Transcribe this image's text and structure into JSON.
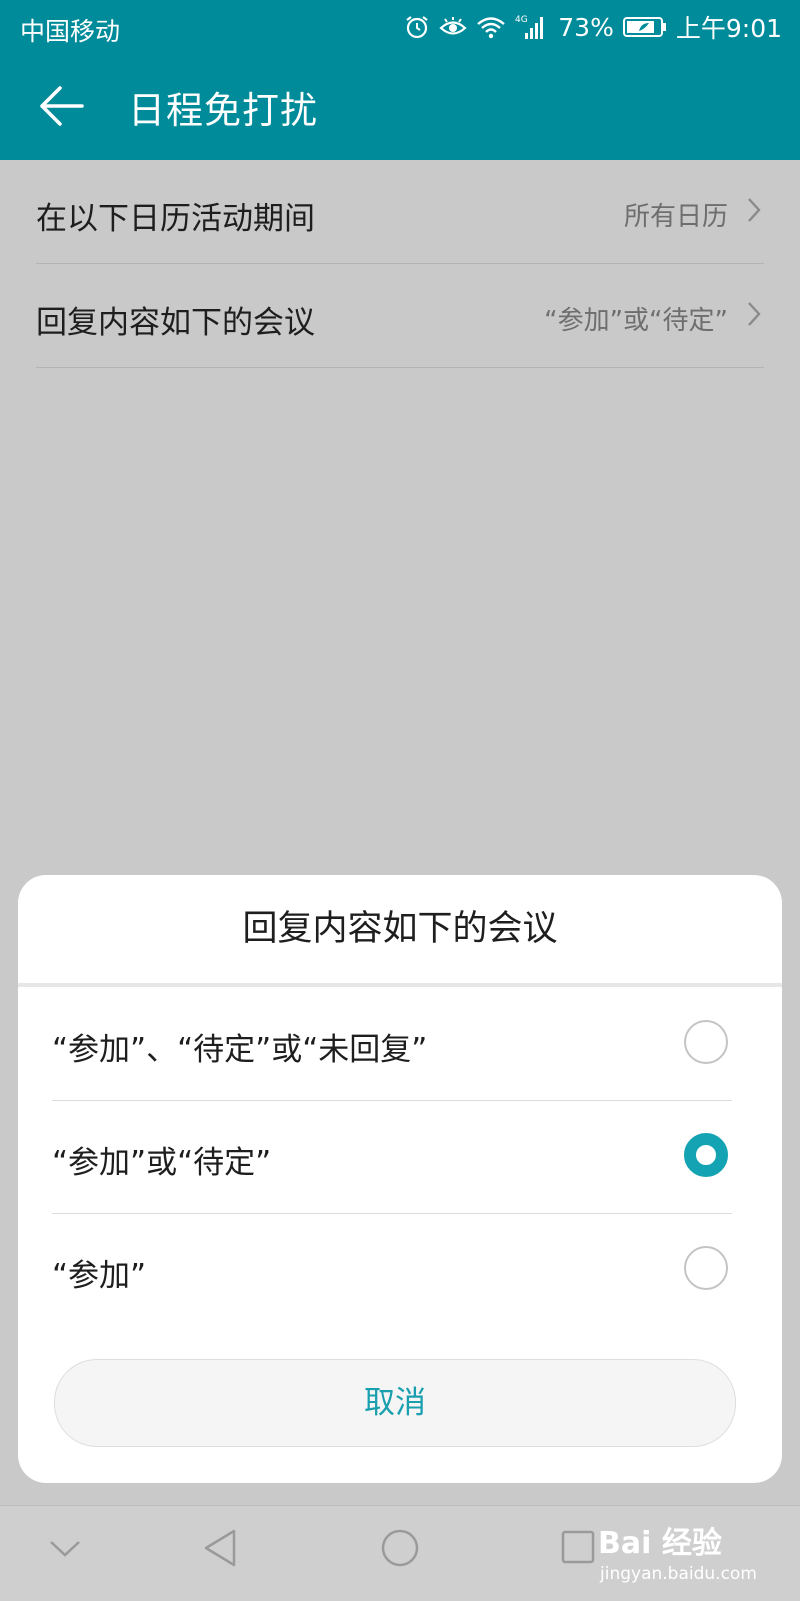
{
  "status_bar": {
    "carrier": "中国移动",
    "network": "4G",
    "battery": "73%",
    "time": "上午9:01",
    "icons": [
      "alarm-icon",
      "eye-comfort-icon",
      "wifi-icon",
      "signal-icon",
      "battery-icon"
    ]
  },
  "header": {
    "back_icon": "back-arrow-icon",
    "title": "日程免打扰"
  },
  "settings": [
    {
      "label": "在以下日历活动期间",
      "value": "所有日历"
    },
    {
      "label": "回复内容如下的会议",
      "value": "“参加”或“待定”"
    }
  ],
  "dialog": {
    "title": "回复内容如下的会议",
    "options": [
      {
        "label": "“参加”、“待定”或“未回复”",
        "selected": false
      },
      {
        "label": "“参加”或“待定”",
        "selected": true
      },
      {
        "label": "“参加”",
        "selected": false
      }
    ],
    "cancel_label": "取消"
  },
  "nav_bar": {
    "icons": [
      "collapse-chevron-icon",
      "back-triangle-icon",
      "home-circle-icon",
      "recents-square-icon"
    ]
  },
  "watermark": {
    "logo": "Bai 经验",
    "url": "jingyan.baidu.com"
  },
  "colors": {
    "accent": "#008b9a",
    "radio_selected": "#13a3b3",
    "cancel_text": "#1a9fae",
    "overlay": "#c9c9c9"
  }
}
